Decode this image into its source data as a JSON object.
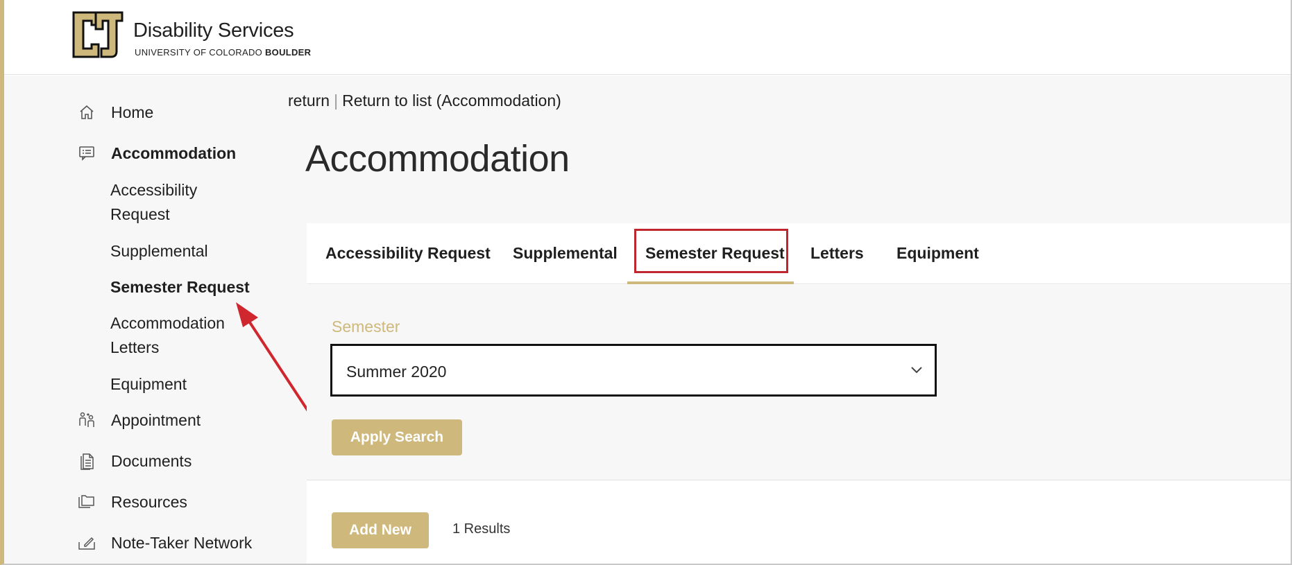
{
  "header": {
    "brand_title": "Disability Services",
    "brand_sub_regular": "UNIVERSITY OF COLORADO ",
    "brand_sub_bold": "BOULDER",
    "logo_icon": "cu-logo-icon"
  },
  "sidebar": {
    "items": [
      {
        "label": "Home",
        "icon": "home-icon"
      },
      {
        "label": "Accommodation",
        "icon": "chat-list-icon"
      },
      {
        "label": "Appointment",
        "icon": "people-icon"
      },
      {
        "label": "Documents",
        "icon": "documents-icon"
      },
      {
        "label": "Resources",
        "icon": "folders-icon"
      },
      {
        "label": "Note-Taker Network",
        "icon": "note-icon"
      }
    ],
    "sub_items": [
      {
        "label": "Accessibility Request"
      },
      {
        "label": "Supplemental"
      },
      {
        "label": "Semester Request"
      },
      {
        "label": "Accommodation Letters"
      },
      {
        "label": "Equipment"
      }
    ]
  },
  "breadcrumb": {
    "return": "return",
    "separator": "|",
    "return_list": "Return to list (Accommodation)"
  },
  "page_title": "Accommodation",
  "tabs": [
    {
      "label": "Accessibility Request"
    },
    {
      "label": "Supplemental"
    },
    {
      "label": "Semester Request"
    },
    {
      "label": "Letters"
    },
    {
      "label": "Equipment"
    }
  ],
  "filter": {
    "label": "Semester",
    "selected": "Summer 2020",
    "apply_label": "Apply Search"
  },
  "list": {
    "add_label": "Add New",
    "results_text": "1 Results"
  },
  "colors": {
    "gold": "#cfb87c",
    "highlight_red": "#c0262d"
  }
}
